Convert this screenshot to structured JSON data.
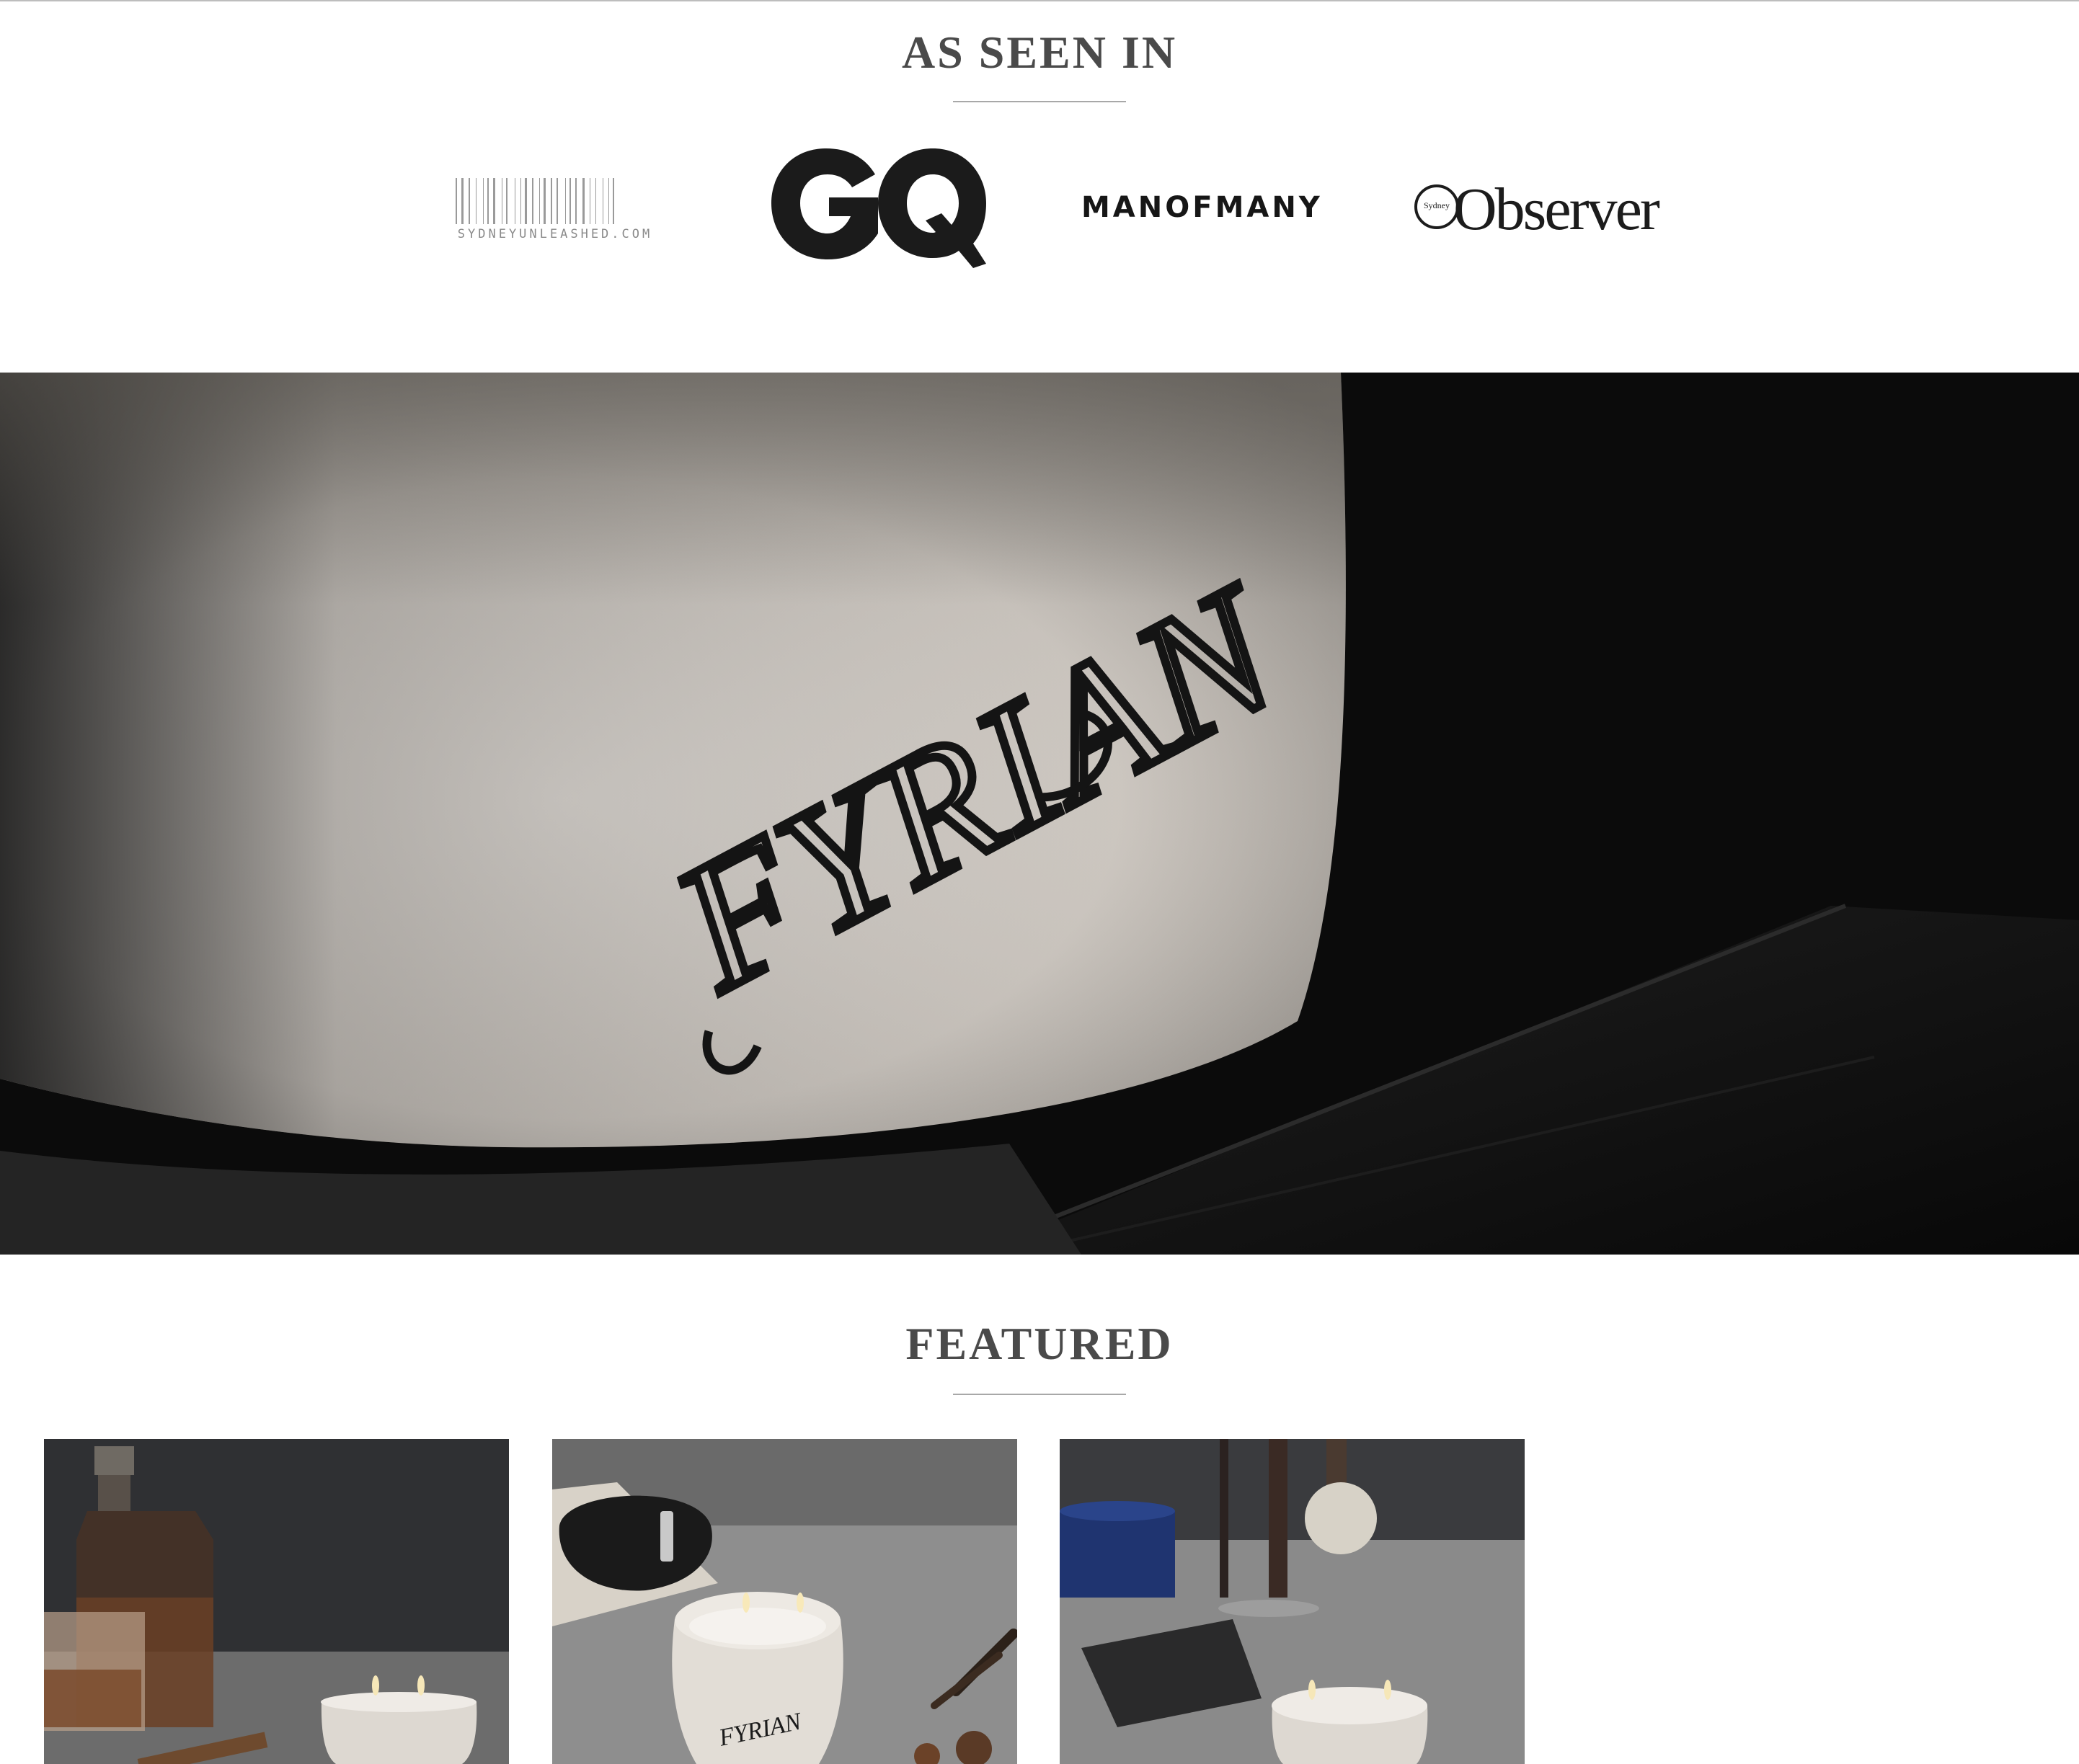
{
  "as_seen_in": {
    "title": "AS SEEN IN",
    "logos": [
      {
        "name": "SydneyUnleashed",
        "text": "SYDNEYUNLEASHED.COM"
      },
      {
        "name": "GQ",
        "text": "GQ"
      },
      {
        "name": "Man of Many",
        "text": "MANOFMANY"
      },
      {
        "name": "Sydney Observer",
        "small_text": "Sydney",
        "text": "Observer"
      }
    ]
  },
  "hero": {
    "brand_mark": "FYRIAN"
  },
  "featured": {
    "title": "FEATURED",
    "cards": [
      {
        "image": "candle-with-whisky-decanter"
      },
      {
        "image": "candle-with-leather-belt",
        "candle_label": "FYRIAN"
      },
      {
        "image": "candle-with-shaving-brush"
      }
    ]
  },
  "colors": {
    "heading": "#4a4a4a",
    "rule": "#a8a8a8",
    "hero_dark": "#0b0b0b",
    "concrete": "#d9d3cc"
  }
}
